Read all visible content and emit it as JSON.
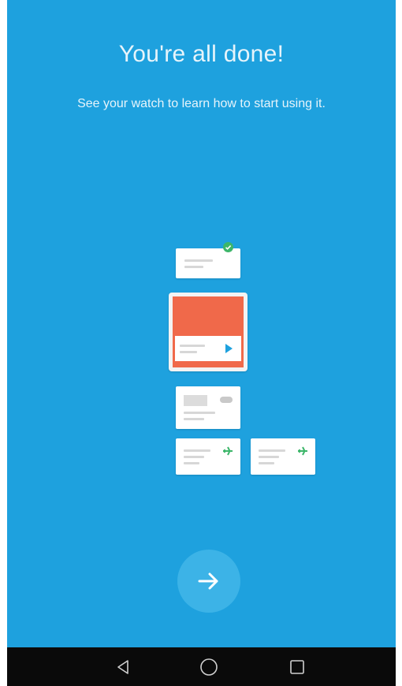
{
  "onboarding": {
    "title": "You're all done!",
    "subtitle": "See your watch to learn how to start using it."
  },
  "illustration": {
    "accent_color": "#f0694a",
    "check_color": "#3db66a",
    "play_color": "#1ea1de",
    "plane_color": "#3db66a",
    "icons": [
      "check-badge-icon",
      "play-icon",
      "cloud-icon",
      "airplane-icon",
      "airplane-icon"
    ]
  },
  "actions": {
    "next_icon": "arrow-right-icon"
  },
  "navbar": {
    "items": [
      {
        "name": "back",
        "icon": "triangle-left-icon"
      },
      {
        "name": "home",
        "icon": "circle-icon"
      },
      {
        "name": "recents",
        "icon": "square-icon"
      }
    ]
  },
  "colors": {
    "background": "#1ea1de",
    "button": "#3cb3e7",
    "navbar": "#0a0a0a"
  }
}
